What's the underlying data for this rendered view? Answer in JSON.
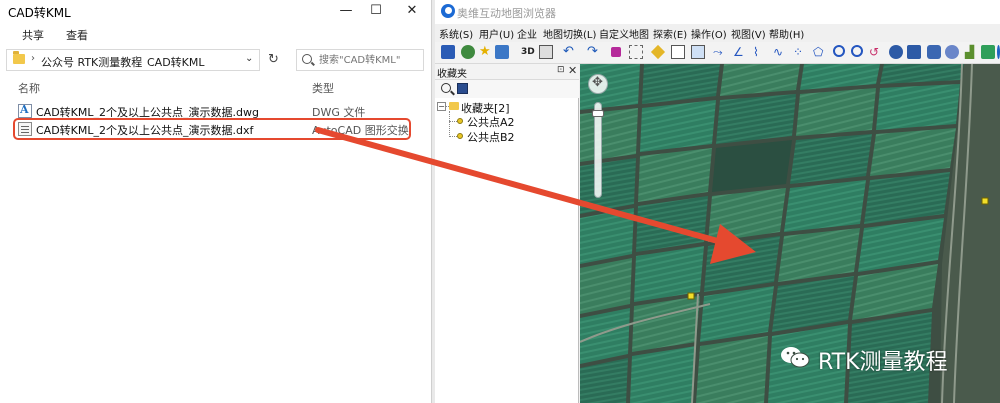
{
  "explorer": {
    "title": "CAD转KML",
    "ribbon": {
      "share": "共享",
      "view": "查看"
    },
    "breadcrumb": [
      "公众号 RTK测量教程",
      "CAD转KML"
    ],
    "search_placeholder": "搜索\"CAD转KML\"",
    "columns": {
      "name": "名称",
      "type": "类型"
    },
    "files": [
      {
        "name": "CAD转KML_2个及以上公共点_演示数据.dwg",
        "type": "DWG 文件",
        "icon": "dwg-file-icon"
      },
      {
        "name": "CAD转KML_2个及以上公共点_演示数据.dxf",
        "type": "AutoCAD 图形交换",
        "icon": "dxf-file-icon",
        "highlighted": true
      }
    ],
    "window_buttons": {
      "minimize": "—",
      "maximize": "☐",
      "close": "✕"
    }
  },
  "map_browser": {
    "title": "奥维互动地图浏览器",
    "menu": [
      "系统(S)",
      "用户(U)",
      "企业",
      "地图切换(L)",
      "自定义地图",
      "探索(E)",
      "操作(O)",
      "视图(V)",
      "帮助(H)"
    ],
    "panel": {
      "title": "收藏夹",
      "pin": "⊡",
      "close": "✕",
      "tree": {
        "root": "收藏夹[2]",
        "children": [
          "公共点A2",
          "公共点B2"
        ]
      }
    }
  },
  "watermark": {
    "text": "RTK测量教程",
    "icon": "wechat-icon"
  },
  "colors": {
    "highlight_border": "#e5492f",
    "arrow": "#e5492f",
    "map_base": "#35473c",
    "field_green": "#2f7e62",
    "placemark": "#f2de2a"
  }
}
